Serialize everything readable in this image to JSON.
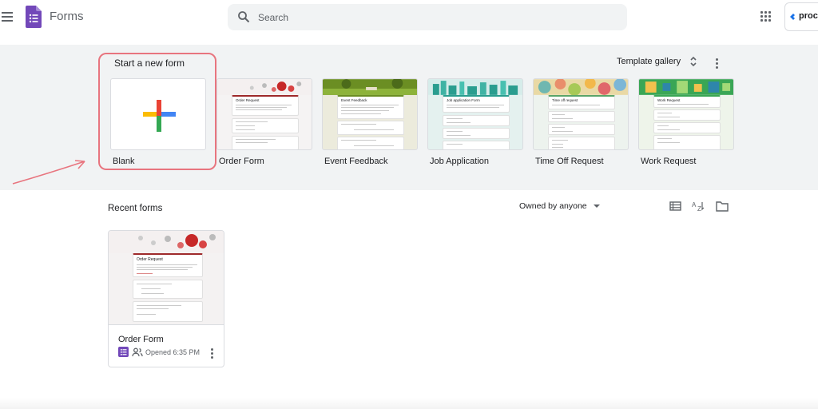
{
  "header": {
    "app_title": "Forms",
    "search_placeholder": "Search",
    "account_text": "proces"
  },
  "templates": {
    "section_title": "Start a new form",
    "gallery_label": "Template gallery",
    "items": [
      {
        "label": "Blank"
      },
      {
        "label": "Order Form",
        "form_title": "Order Request"
      },
      {
        "label": "Event Feedback",
        "form_title": "Event Feedback"
      },
      {
        "label": "Job Application",
        "form_title": "Job application Form"
      },
      {
        "label": "Time Off Request",
        "form_title": "Time off request"
      },
      {
        "label": "Work Request",
        "form_title": "Work Request"
      }
    ]
  },
  "recent": {
    "section_title": "Recent forms",
    "owner_filter": "Owned by anyone",
    "documents": [
      {
        "title": "Order Form",
        "form_title": "Order Request",
        "opened": "Opened 6:35 PM"
      }
    ]
  },
  "colors": {
    "forms_purple": "#7248b9",
    "highlight_pink": "#e8757f",
    "band_gray": "#f1f3f4",
    "plus_red": "#ea4335",
    "plus_blue": "#4285f4",
    "plus_green": "#34a853",
    "plus_yellow": "#fbbc04"
  },
  "icons": {
    "menu": "hamburger-icon",
    "search": "search-icon",
    "apps": "apps-grid-icon",
    "gallery_toggle": "unfold-more-icon",
    "options": "more-vert-icon",
    "list_view": "list-view-icon",
    "sort": "sort-az-icon",
    "folder": "folder-icon",
    "shared": "people-icon"
  }
}
